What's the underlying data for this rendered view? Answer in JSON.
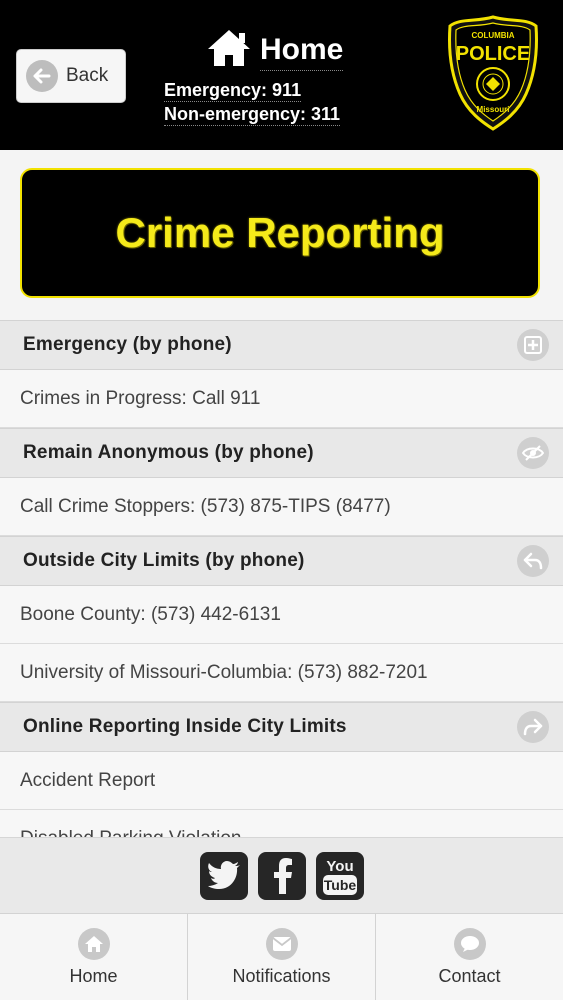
{
  "header": {
    "back_label": "Back",
    "title": "Home",
    "emergency": "Emergency: 911",
    "non_emergency": "Non-emergency: 311",
    "logo_text": {
      "top": "COLUMBIA",
      "main": "POLICE",
      "bottom": "Missouri"
    }
  },
  "banner": {
    "title": "Crime Reporting"
  },
  "sections": [
    {
      "title": "Emergency (by phone)",
      "icon": "plus-icon",
      "items": [
        "Crimes in Progress: Call 911"
      ]
    },
    {
      "title": "Remain Anonymous (by phone)",
      "icon": "eye-slash-icon",
      "items": [
        "Call Crime Stoppers: (573) 875-TIPS (8477)"
      ]
    },
    {
      "title": "Outside City Limits (by phone)",
      "icon": "back-arrow-icon",
      "items": [
        "Boone County: (573) 442-6131",
        "University of Missouri-Columbia: (573) 882-7201"
      ]
    },
    {
      "title": "Online Reporting Inside City Limits",
      "icon": "forward-arrow-icon",
      "items": [
        "Accident Report",
        "Disabled Parking Violation"
      ]
    }
  ],
  "social": [
    {
      "name": "twitter-icon"
    },
    {
      "name": "facebook-icon"
    },
    {
      "name": "youtube-icon"
    }
  ],
  "tabbar": {
    "home": "Home",
    "notifications": "Notifications",
    "contact": "Contact"
  },
  "colors": {
    "header_bg": "#000000",
    "accent_yellow": "#f5ea1a",
    "section_bg": "#e8e8e8",
    "row_bg": "#f7f7f7"
  }
}
